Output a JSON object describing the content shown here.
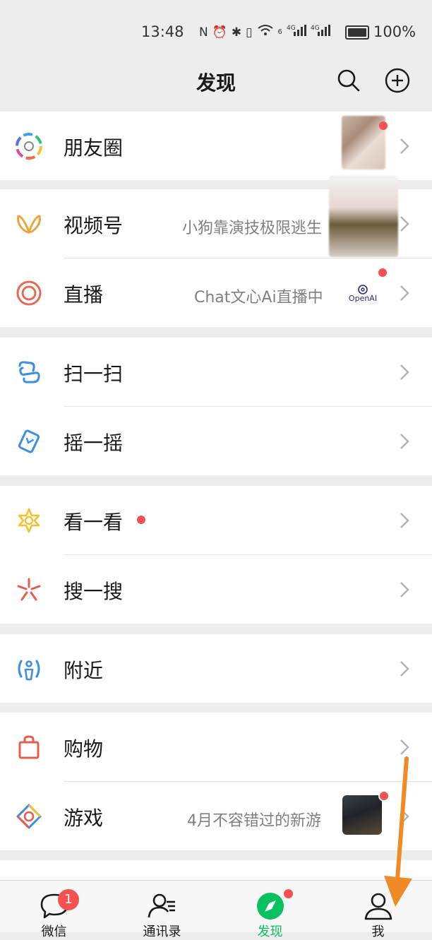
{
  "status_bar": {
    "time": "13:48",
    "network_1": "6",
    "network_2": "4G",
    "network_3": "4G",
    "battery_pct": "100%"
  },
  "header": {
    "title": "发现"
  },
  "groups": [
    {
      "rows": [
        {
          "label": "朋友圈"
        }
      ]
    },
    {
      "rows": [
        {
          "label": "视频号",
          "sub": "小狗靠演技极限逃生"
        },
        {
          "label": "直播",
          "sub": "Chat文心Ai直播中",
          "thumb_text": "OpenAI"
        }
      ]
    },
    {
      "rows": [
        {
          "label": "扫一扫"
        },
        {
          "label": "摇一摇"
        }
      ]
    },
    {
      "rows": [
        {
          "label": "看一看"
        },
        {
          "label": "搜一搜"
        }
      ]
    },
    {
      "rows": [
        {
          "label": "附近"
        }
      ]
    },
    {
      "rows": [
        {
          "label": "购物"
        },
        {
          "label": "游戏",
          "sub": "4月不容错过的新游"
        }
      ]
    }
  ],
  "tabbar": {
    "tabs": [
      {
        "label": "微信",
        "badge": "1"
      },
      {
        "label": "通讯录"
      },
      {
        "label": "发现"
      },
      {
        "label": "我"
      }
    ]
  },
  "colors": {
    "accent": "#07c160",
    "badge": "#f5524f",
    "annotation_arrow": "#f08a24"
  }
}
